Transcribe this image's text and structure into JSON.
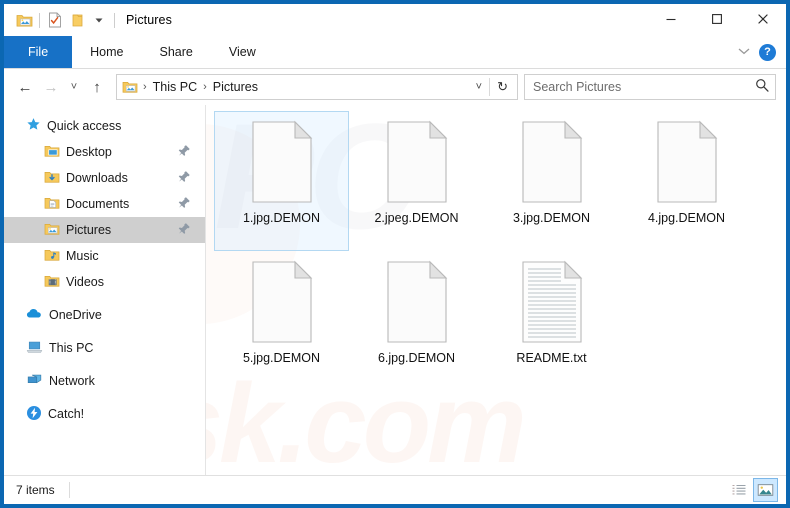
{
  "window": {
    "title": "Pictures",
    "quick_access_toolbar": [
      {
        "name": "pictures-folder-icon",
        "label": "Pictures"
      },
      {
        "name": "properties-icon",
        "label": "Properties"
      },
      {
        "name": "new-folder-icon",
        "label": "New folder"
      },
      {
        "name": "customize-qat-dropdown",
        "label": "Customize Quick Access Toolbar"
      }
    ],
    "controls": {
      "minimize": "—",
      "maximize": "□",
      "close": "✕"
    }
  },
  "ribbon": {
    "tabs": [
      {
        "label": "File",
        "active": true
      },
      {
        "label": "Home",
        "active": false
      },
      {
        "label": "Share",
        "active": false
      },
      {
        "label": "View",
        "active": false
      }
    ],
    "expand_icon": "chevron-down-icon",
    "help_label": "?"
  },
  "address_bar": {
    "back": "←",
    "forward": "→",
    "recent": "˅",
    "up": "↑",
    "breadcrumbs": [
      "This PC",
      "Pictures"
    ],
    "separator": "›",
    "dropdown": "˅",
    "refresh": "↻"
  },
  "search": {
    "placeholder": "Search Pictures",
    "icon": "search-icon"
  },
  "sidebar": {
    "items": [
      {
        "label": "Quick access",
        "icon": "star-icon",
        "indent": false,
        "pinned": false,
        "selected": false
      },
      {
        "label": "Desktop",
        "icon": "desktop-folder-icon",
        "indent": true,
        "pinned": true,
        "selected": false
      },
      {
        "label": "Downloads",
        "icon": "downloads-folder-icon",
        "indent": true,
        "pinned": true,
        "selected": false
      },
      {
        "label": "Documents",
        "icon": "documents-folder-icon",
        "indent": true,
        "pinned": true,
        "selected": false
      },
      {
        "label": "Pictures",
        "icon": "pictures-folder-icon",
        "indent": true,
        "pinned": true,
        "selected": true
      },
      {
        "label": "Music",
        "icon": "music-folder-icon",
        "indent": true,
        "pinned": false,
        "selected": false
      },
      {
        "label": "Videos",
        "icon": "videos-folder-icon",
        "indent": true,
        "pinned": false,
        "selected": false
      },
      {
        "label": "OneDrive",
        "icon": "onedrive-cloud-icon",
        "indent": false,
        "pinned": false,
        "selected": false
      },
      {
        "label": "This PC",
        "icon": "this-pc-icon",
        "indent": false,
        "pinned": false,
        "selected": false
      },
      {
        "label": "Network",
        "icon": "network-icon",
        "indent": false,
        "pinned": false,
        "selected": false
      },
      {
        "label": "Catch!",
        "icon": "catch-icon",
        "indent": false,
        "pinned": false,
        "selected": false
      }
    ]
  },
  "files": [
    {
      "name": "1.jpg.DEMON",
      "type": "blank",
      "selected": true
    },
    {
      "name": "2.jpeg.DEMON",
      "type": "blank",
      "selected": false
    },
    {
      "name": "3.jpg.DEMON",
      "type": "blank",
      "selected": false
    },
    {
      "name": "4.jpg.DEMON",
      "type": "blank",
      "selected": false
    },
    {
      "name": "5.jpg.DEMON",
      "type": "blank",
      "selected": false
    },
    {
      "name": "6.jpg.DEMON",
      "type": "blank",
      "selected": false
    },
    {
      "name": "README.txt",
      "type": "text",
      "selected": false
    }
  ],
  "status_bar": {
    "item_count": "7 items",
    "views": [
      {
        "name": "details-view-button",
        "active": false
      },
      {
        "name": "large-icons-view-button",
        "active": true
      }
    ]
  },
  "watermark": {
    "top_text": "PC",
    "bottom_text": "risk.com"
  },
  "colors": {
    "accent": "#0b67b2",
    "file_tab": "#1771c6",
    "selection": "#cde8ff",
    "selection_border": "#b3d8f2",
    "sidebar_selected": "#cfcfcf"
  }
}
